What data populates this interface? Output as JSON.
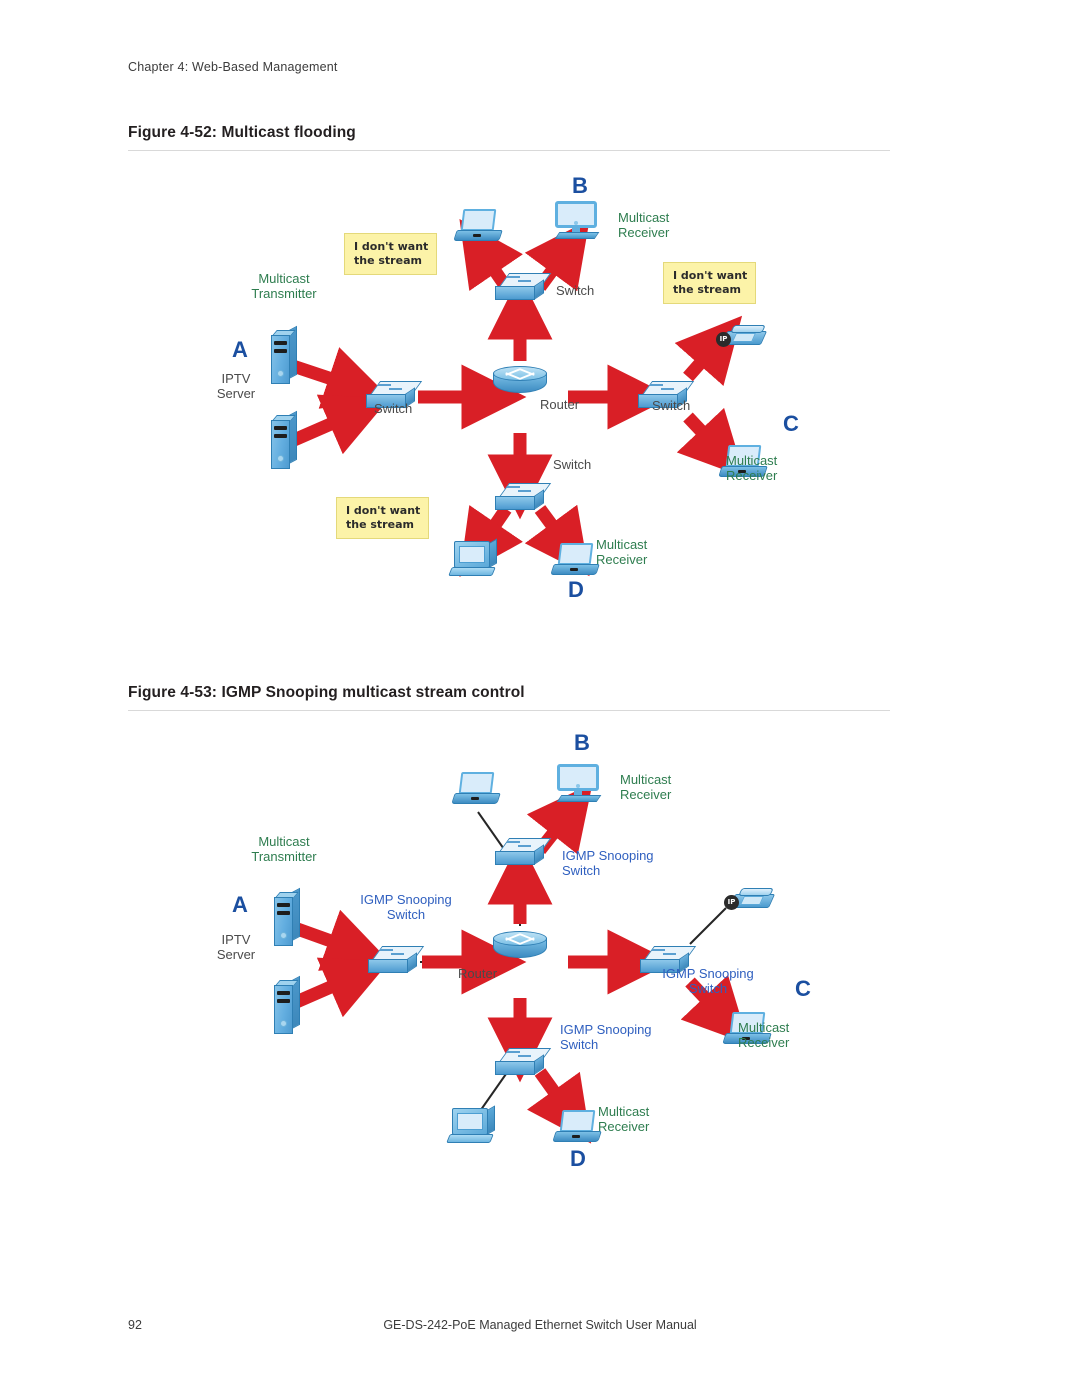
{
  "document": {
    "running_head": "Chapter 4: Web-Based Management",
    "footer_page_number": "92",
    "footer_title": "GE-DS-242-PoE Managed Ethernet Switch User Manual"
  },
  "colors": {
    "green_label": "#2e7d4f",
    "blue_label": "#2f5fbf",
    "node_letter": "#1b4fa0",
    "grey_label": "#3e3e3e",
    "arrow_red": "#d91f26",
    "callout_fill": "#fcf3a8",
    "rule": "#d9d9d9"
  },
  "figures": [
    {
      "id": "figure-52",
      "caption": "Figure 4-52: Multicast flooding",
      "nodes": [
        {
          "id": "a",
          "letter": "A"
        },
        {
          "id": "b",
          "letter": "B"
        },
        {
          "id": "c",
          "letter": "C"
        },
        {
          "id": "d",
          "letter": "D"
        }
      ],
      "labels": {
        "multicast_transmitter": "Multicast\nTransmitter",
        "iptv_server": "IPTV\nServer",
        "switch_left": "Switch",
        "switch_top": "Switch",
        "switch_right": "Switch",
        "switch_bottom": "Switch",
        "router": "Router",
        "receiver_b": "Multicast\nReceiver",
        "receiver_c": "Multicast\nReceiver",
        "receiver_d": "Multicast\nReceiver"
      },
      "callouts": [
        {
          "id": "callout-b",
          "text": "I don't want\nthe stream"
        },
        {
          "id": "callout-c",
          "text": "I don't want\nthe stream"
        },
        {
          "id": "callout-d",
          "text": "I don't want\nthe stream"
        }
      ]
    },
    {
      "id": "figure-53",
      "caption": "Figure 4-53: IGMP Snooping multicast stream control",
      "nodes": [
        {
          "id": "a",
          "letter": "A"
        },
        {
          "id": "b",
          "letter": "B"
        },
        {
          "id": "c",
          "letter": "C"
        },
        {
          "id": "d",
          "letter": "D"
        }
      ],
      "labels": {
        "multicast_transmitter": "Multicast\nTransmitter",
        "iptv_server": "IPTV\nServer",
        "switch_left": "IGMP Snooping\nSwitch",
        "switch_top": "IGMP Snooping\nSwitch",
        "switch_right": "IGMP Snooping\nSwitch",
        "switch_bottom": "IGMP Snooping\nSwitch",
        "router": "Router",
        "receiver_b": "Multicast\nReceiver",
        "receiver_c": "Multicast\nReceiver",
        "receiver_d": "Multicast\nReceiver"
      },
      "callouts": []
    }
  ]
}
